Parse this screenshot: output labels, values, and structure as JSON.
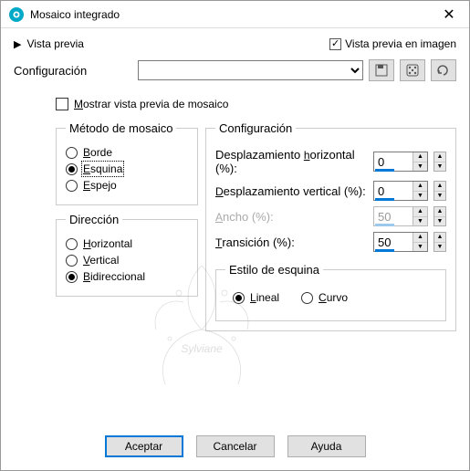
{
  "window": {
    "title": "Mosaico integrado"
  },
  "preview": {
    "expander": "Vista previa",
    "inImage": "Vista previa en imagen",
    "inImageChecked": true
  },
  "configRow": {
    "label": "Configuración",
    "value": ""
  },
  "showPreview": {
    "label": "Mostrar vista previa de mosaico",
    "accel": "M",
    "checked": false
  },
  "method": {
    "legend": "Método de mosaico",
    "options": [
      {
        "label": "Borde",
        "accel": "B",
        "selected": false
      },
      {
        "label": "Esquina",
        "accel": "E",
        "selected": true
      },
      {
        "label": "Espejo",
        "accel": "E",
        "selected": false
      }
    ]
  },
  "direction": {
    "legend": "Dirección",
    "options": [
      {
        "label": "Horizontal",
        "accel": "H",
        "selected": false
      },
      {
        "label": "Vertical",
        "accel": "V",
        "selected": false
      },
      {
        "label": "Bidireccional",
        "accel": "B",
        "selected": true
      }
    ]
  },
  "settings": {
    "legend": "Configuración",
    "items": [
      {
        "label_pre": "Desplazamiento ",
        "accel": "h",
        "label_post": "orizontal (%):",
        "value": 0,
        "barPct": 50,
        "disabled": false
      },
      {
        "label_pre": "",
        "accel": "D",
        "label_post": "esplazamiento vertical (%):",
        "value": 0,
        "barPct": 50,
        "disabled": false
      },
      {
        "label_pre": "",
        "accel": "A",
        "label_post": "ncho (%):",
        "value": 50,
        "barPct": 50,
        "disabled": true
      },
      {
        "label_pre": "",
        "accel": "T",
        "label_post": "ransición (%):",
        "value": 50,
        "barPct": 50,
        "disabled": false
      }
    ]
  },
  "cornerStyle": {
    "legend": "Estilo de esquina",
    "options": [
      {
        "label": "Lineal",
        "accel": "L",
        "selected": true
      },
      {
        "label": "Curvo",
        "accel": "C",
        "selected": false
      }
    ]
  },
  "buttons": {
    "ok": "Aceptar",
    "cancel": "Cancelar",
    "help": "Ayuda"
  }
}
